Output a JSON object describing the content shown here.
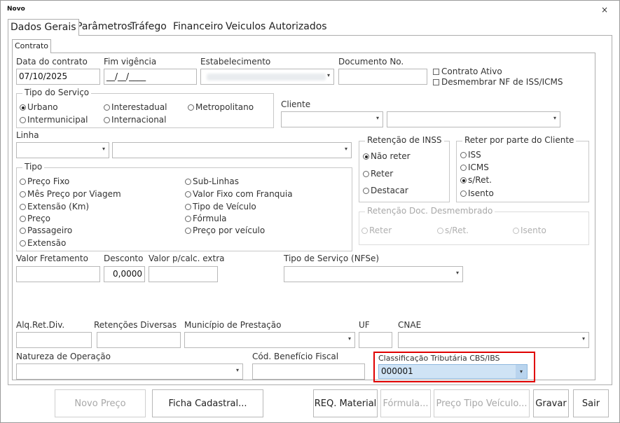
{
  "window": {
    "title": "Novo",
    "close_label": "×"
  },
  "tabs": [
    {
      "label": "Dados Gerais",
      "active": true
    },
    {
      "label": "Parâmetros"
    },
    {
      "label": "Tráfego"
    },
    {
      "label": "Financeiro"
    },
    {
      "label": "Veiculos Autorizados"
    }
  ],
  "subtab": {
    "label": "Contrato"
  },
  "fields": {
    "data_contrato": {
      "label": "Data do contrato",
      "value": "07/10/2025"
    },
    "fim_vigencia": {
      "label": "Fim vigência",
      "value": "__/__/____"
    },
    "estabelecimento": {
      "label": "Estabelecimento"
    },
    "documento_no": {
      "label": "Documento No.",
      "value": ""
    },
    "contrato_ativo": {
      "label": "Contrato Ativo",
      "checked": false
    },
    "desmembrar_nf": {
      "label": "Desmembrar NF de ISS/ICMS",
      "checked": false
    },
    "cliente": {
      "label": "Cliente"
    },
    "linha": {
      "label": "Linha"
    },
    "valor_fretamento": {
      "label": "Valor Fretamento",
      "value": ""
    },
    "desconto": {
      "label": "Desconto",
      "value": "0,0000"
    },
    "valor_calc_extra": {
      "label": "Valor p/calc. extra",
      "value": ""
    },
    "tipo_servico_nfse": {
      "label": "Tipo de Serviço (NFSe)"
    },
    "alq_ret_div": {
      "label": "Alq.Ret.Div."
    },
    "retencoes_diversas": {
      "label": "Retenções Diversas"
    },
    "municipio_prestacao": {
      "label": "Município de Prestação"
    },
    "uf": {
      "label": "UF"
    },
    "cnae": {
      "label": "CNAE"
    },
    "natureza_operacao": {
      "label": "Natureza de Operação"
    },
    "cod_beneficio_fiscal": {
      "label": "Cód. Benefício Fiscal"
    },
    "classificacao_tributaria": {
      "label": "Classificação Tributária CBS/IBS",
      "value": "000001"
    }
  },
  "tipo_servico": {
    "title": "Tipo do Serviço",
    "options": [
      "Urbano",
      "Interestadual",
      "Metropolitano",
      "Intermunicipal",
      "Internacional"
    ],
    "selected": "Urbano"
  },
  "retencao_inss": {
    "title": "Retenção de INSS",
    "options": [
      "Não reter",
      "Reter",
      "Destacar"
    ],
    "selected": "Não reter"
  },
  "reter_cliente": {
    "title": "Reter por parte do Cliente",
    "options": [
      "ISS",
      "ICMS",
      "s/Ret.",
      "Isento"
    ],
    "selected": "s/Ret."
  },
  "tipo": {
    "title": "Tipo",
    "options": [
      "Preço Fixo",
      "Mês Preço por Viagem",
      "Extensão (Km)",
      "Preço",
      "Passageiro",
      "Extensão",
      "Sub-Linhas",
      "Valor Fixo com Franquia",
      "Tipo de Veículo",
      "Fórmula",
      "Preço por veículo"
    ]
  },
  "retencao_doc": {
    "title": "Retenção Doc. Desmembrado",
    "options": [
      "Reter",
      "s/Ret.",
      "Isento"
    ]
  },
  "buttons": {
    "novo_preco": "Novo Preço",
    "ficha_cadastral": "Ficha Cadastral...",
    "req_material": "REQ. Material",
    "formula": "Fórmula...",
    "preco_tipo_veiculo": "Preço Tipo Veículo...",
    "gravar": "Gravar",
    "sair": "Sair"
  }
}
